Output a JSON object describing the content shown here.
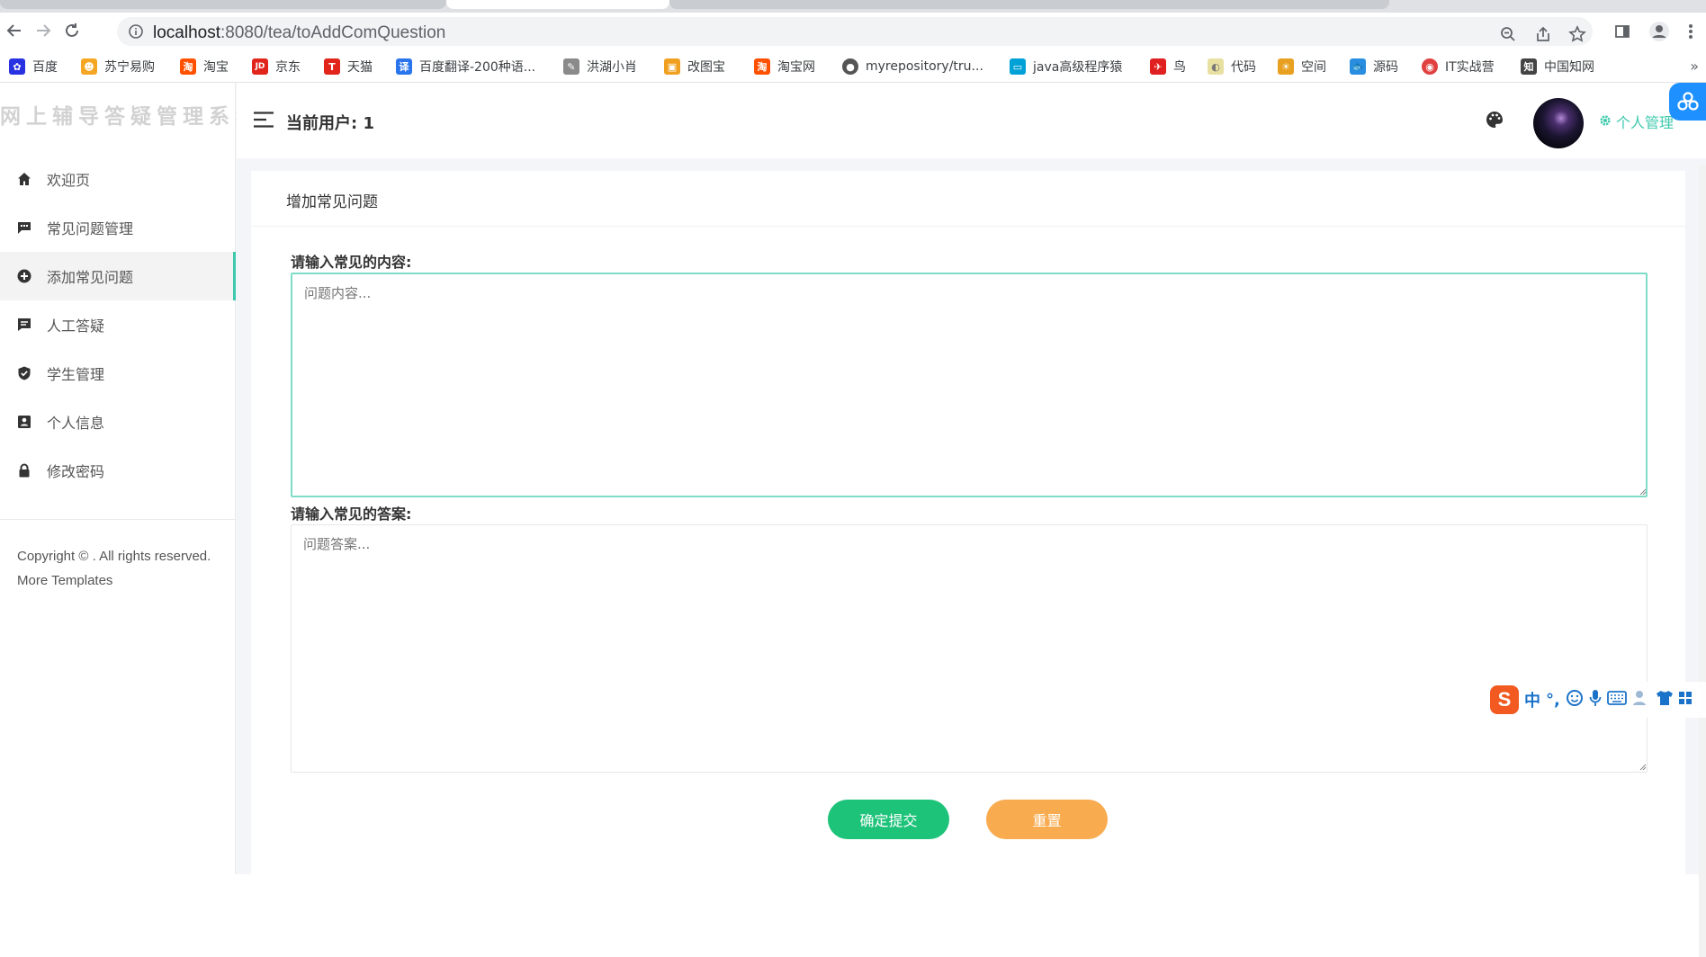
{
  "browser": {
    "url_host": "localhost",
    "url_path": ":8080/tea/toAddComQuestion"
  },
  "bookmarks": [
    {
      "label": "百度",
      "color": "#2932e1",
      "glyph": "✿"
    },
    {
      "label": "苏宁易购",
      "color": "#f5a623",
      "glyph": "☻"
    },
    {
      "label": "淘宝",
      "color": "#ff5000",
      "glyph": "淘"
    },
    {
      "label": "京东",
      "color": "#e1251b",
      "glyph": "JD"
    },
    {
      "label": "天猫",
      "color": "#e1251b",
      "glyph": "T"
    },
    {
      "label": "百度翻译-200种语...",
      "color": "#2a75ed",
      "glyph": "译"
    },
    {
      "label": "洪湖小肖",
      "color": "#8a8a8a",
      "glyph": "✎"
    },
    {
      "label": "改图宝",
      "color": "#f0a020",
      "glyph": "▣"
    },
    {
      "label": "淘宝网",
      "color": "#ff5000",
      "glyph": "淘"
    },
    {
      "label": "myrepository/tru...",
      "color": "#555555",
      "glyph": "●"
    },
    {
      "label": "java高级程序猿",
      "color": "#00a1d6",
      "glyph": "▭"
    },
    {
      "label": "鸟",
      "color": "#e02020",
      "glyph": "✈"
    },
    {
      "label": "代码",
      "color": "#e8e0a0",
      "glyph": "◐"
    },
    {
      "label": "空间",
      "color": "#e8a020",
      "glyph": "☀"
    },
    {
      "label": "源码",
      "color": "#2a8ee0",
      "glyph": "🐟"
    },
    {
      "label": "IT实战营",
      "color": "#e04040",
      "glyph": "◉"
    },
    {
      "label": "中国知网",
      "color": "#444444",
      "glyph": "知"
    }
  ],
  "sidebar": {
    "logo": "网上辅导答疑管理系统",
    "items": [
      {
        "label": "欢迎页",
        "icon": "home-icon"
      },
      {
        "label": "常见问题管理",
        "icon": "comment-icon"
      },
      {
        "label": "添加常见问题",
        "icon": "plus-circle-icon"
      },
      {
        "label": "人工答疑",
        "icon": "message-icon"
      },
      {
        "label": "学生管理",
        "icon": "shield-check-icon"
      },
      {
        "label": "个人信息",
        "icon": "contact-card-icon"
      },
      {
        "label": "修改密码",
        "icon": "lock-icon"
      }
    ],
    "active_index": 2,
    "copyright": "Copyright © . All rights reserved. More Templates"
  },
  "topbar": {
    "current_user": "当前用户: 1",
    "profile_menu": "个人管理"
  },
  "form": {
    "panel_title": "增加常见问题",
    "content_label": "请输入常见的内容:",
    "content_placeholder": "问题内容...",
    "answer_label": "请输入常见的答案:",
    "answer_placeholder": "问题答案...",
    "submit_label": "确定提交",
    "reset_label": "重置"
  },
  "ime": {
    "logo": "S",
    "mode": "中",
    "punct": "°,"
  },
  "colors": {
    "accent": "#3ec9ad",
    "submit": "#1ec37a",
    "reset": "#f8ab4f"
  }
}
